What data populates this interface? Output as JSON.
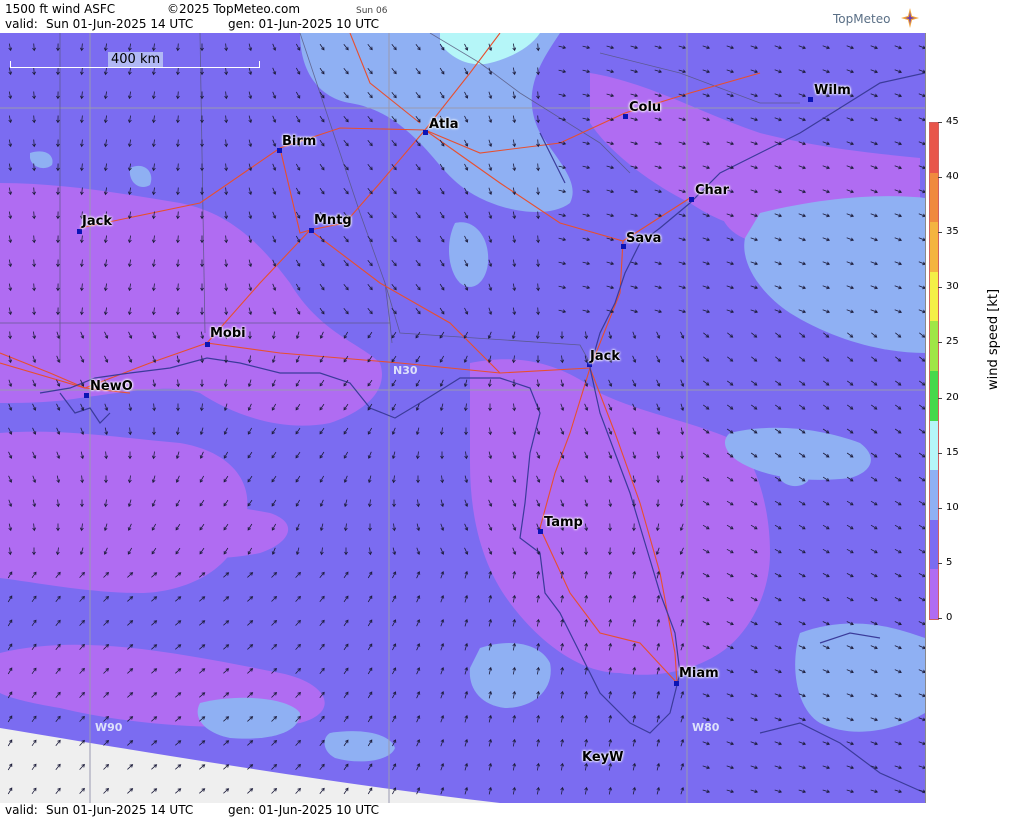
{
  "header": {
    "product": "1500 ft wind ASFC",
    "copyright": "©2025 TopMeteo.com",
    "day_tab": "Sun 06",
    "valid_label": "valid:",
    "valid_time": "Sun  01-Jun-2025  14 UTC",
    "gen_time": "gen: 01-Jun-2025 10 UTC",
    "brand": "TopMeteo"
  },
  "footer": {
    "valid_label": "valid:",
    "valid_time": "Sun  01-Jun-2025  14 UTC",
    "gen_time": "gen: 01-Jun-2025 10 UTC"
  },
  "map": {
    "scale_label": "400 km",
    "grid_labels": {
      "lat_n30": "N30",
      "lon_w90": "W90",
      "lon_w80": "W80"
    },
    "cities": [
      {
        "name": "Birm"
      },
      {
        "name": "Atla"
      },
      {
        "name": "Colu"
      },
      {
        "name": "Wilm"
      },
      {
        "name": "Jack"
      },
      {
        "name": "Mntg"
      },
      {
        "name": "Char"
      },
      {
        "name": "Sava"
      },
      {
        "name": "Mobi"
      },
      {
        "name": "Jack"
      },
      {
        "name": "NewO"
      },
      {
        "name": "Tamp"
      },
      {
        "name": "Miam"
      },
      {
        "name": "KeyW"
      }
    ],
    "colors": {
      "speed_0_5": "#b06cf2",
      "speed_5_10": "#7b6cf1",
      "speed_10_15": "#8fb0f3",
      "speed_15_20": "#a6f2f6",
      "roads": "#e84f2e",
      "coast": "#3b3b9a",
      "grid": "#9a9ab0"
    }
  },
  "legend": {
    "unit_label": "wind speed [kt]",
    "ticks": [
      "45",
      "40",
      "35",
      "30",
      "25",
      "20",
      "15",
      "10",
      "5",
      "0"
    ],
    "color_stops": [
      "#e8554a",
      "#f08a3e",
      "#f4b440",
      "#f4ef46",
      "#9fe646",
      "#46d94b",
      "#b5f6f8",
      "#8fb0f3",
      "#7b6cf1",
      "#b06cf2"
    ]
  }
}
